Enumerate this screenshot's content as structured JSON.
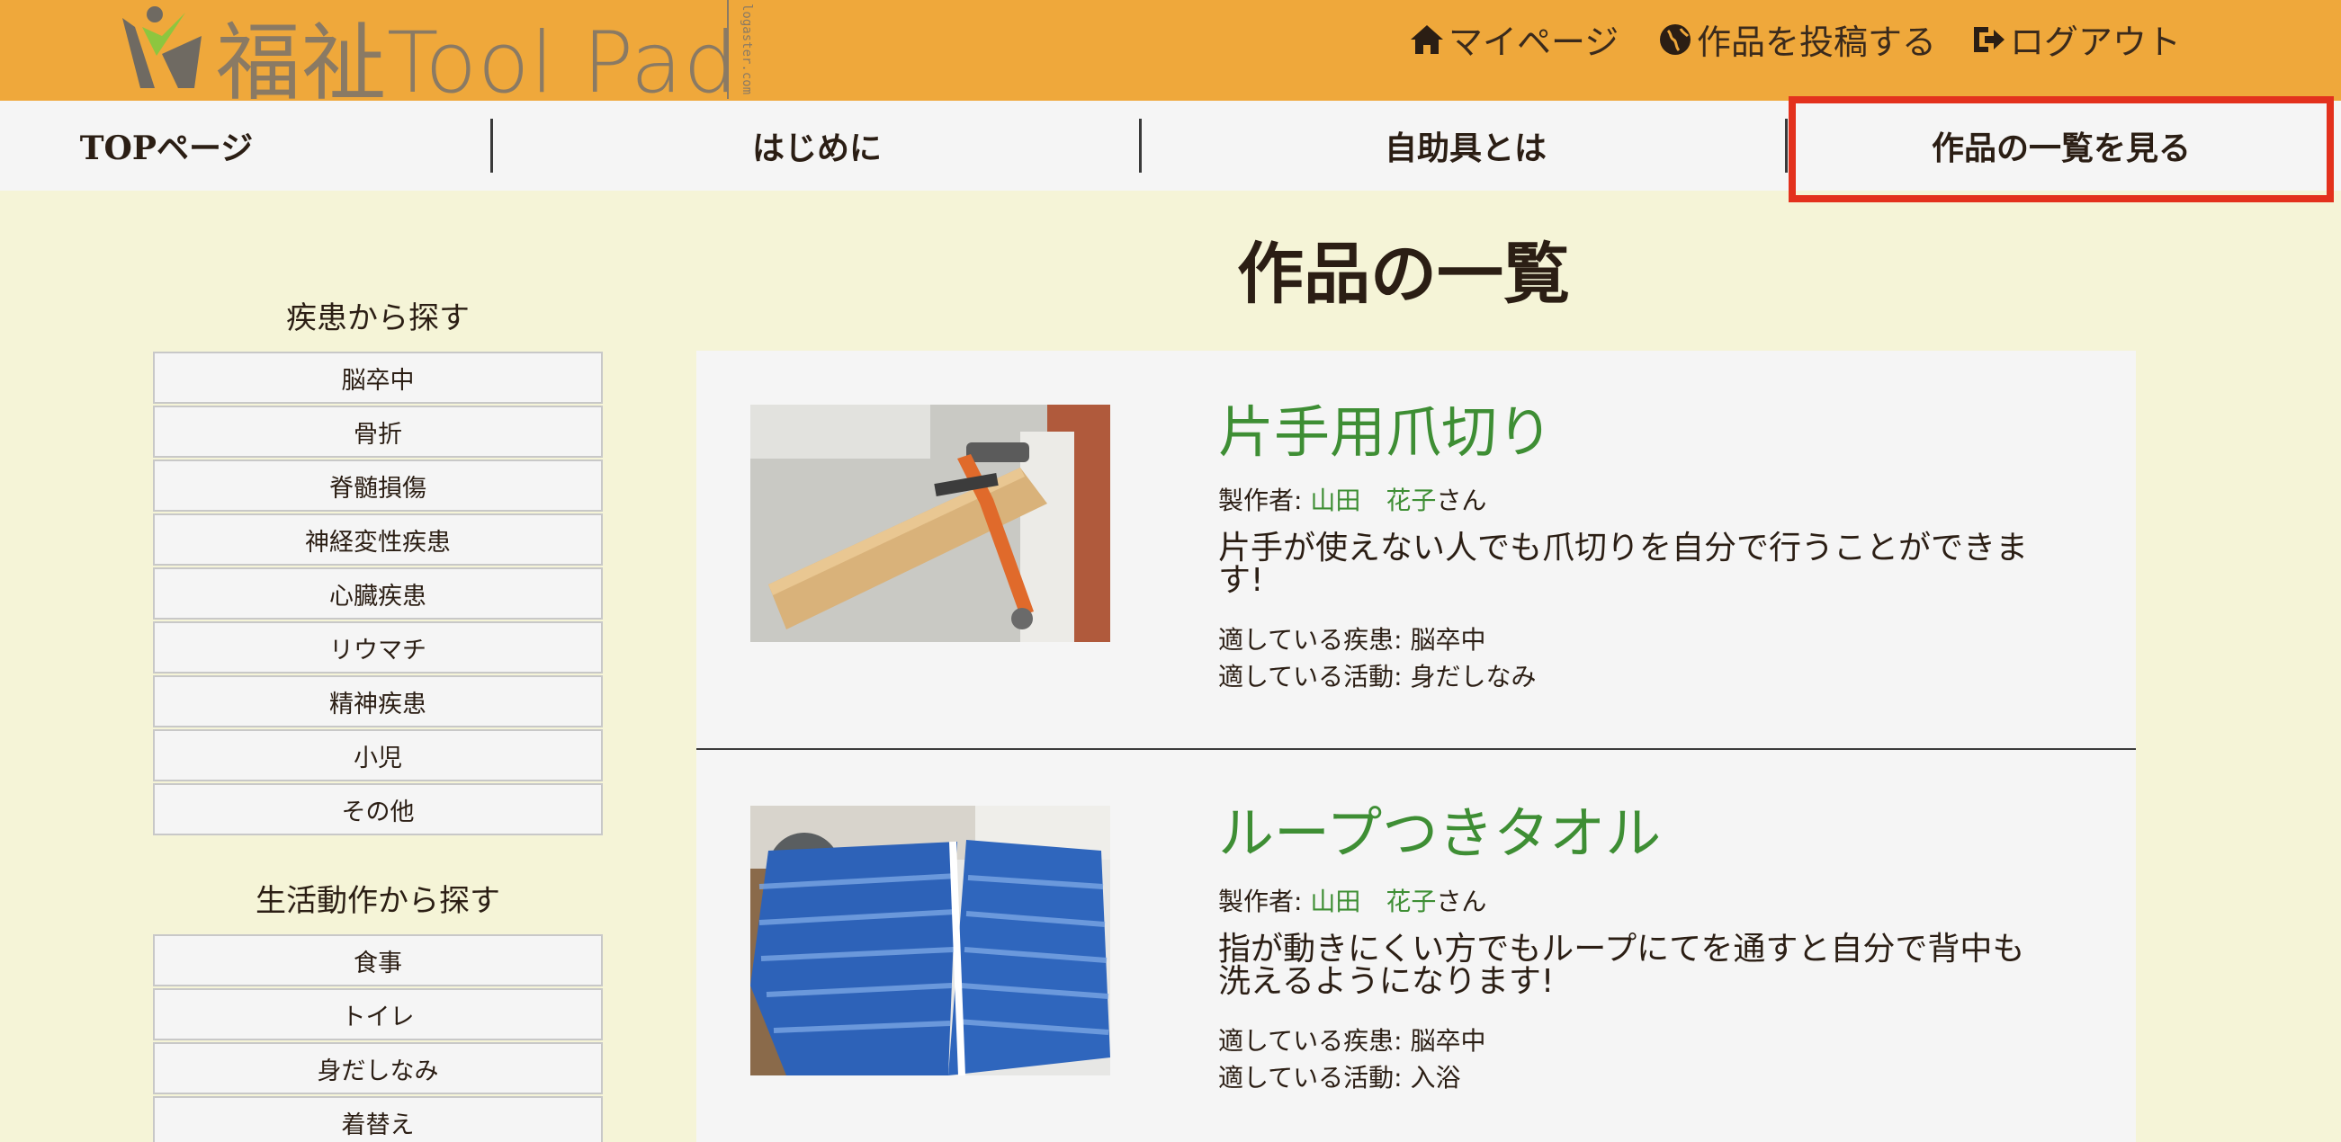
{
  "header": {
    "logo_text": "福祉Tool Pad",
    "logo_credit": "logaster.com",
    "links": [
      {
        "label": "マイページ",
        "icon": "home-icon"
      },
      {
        "label": "作品を投稿する",
        "icon": "globe-icon"
      },
      {
        "label": "ログアウト",
        "icon": "logout-icon"
      }
    ]
  },
  "mainnav": {
    "items": [
      {
        "label": "TOPページ"
      },
      {
        "label": "はじめに"
      },
      {
        "label": "自助具とは"
      },
      {
        "label": "作品の一覧を見る",
        "highlighted": true
      }
    ]
  },
  "page": {
    "title": "作品の一覧"
  },
  "sidebar": {
    "disease_heading": "疾患から探す",
    "diseases": [
      "脳卒中",
      "骨折",
      "脊髄損傷",
      "神経変性疾患",
      "心臓疾患",
      "リウマチ",
      "精神疾患",
      "小児",
      "その他"
    ],
    "activity_heading": "生活動作から探す",
    "activities": [
      "食事",
      "トイレ",
      "身だしなみ",
      "着替え"
    ]
  },
  "works": [
    {
      "title": "片手用爪切り",
      "creator_label": "製作者:",
      "creator_name": "山田　花子",
      "creator_suffix": "さん",
      "description": "片手が使えない人でも爪切りを自分で行うことができます!",
      "disease_label": "適している疾患:",
      "disease": "脳卒中",
      "activity_label": "適している活動:",
      "activity": "身だしなみ"
    },
    {
      "title": "ループつきタオル",
      "creator_label": "製作者:",
      "creator_name": "山田　花子",
      "creator_suffix": "さん",
      "description": "指が動きにくい方でもループにてを通すと自分で背中も洗えるようになります!",
      "disease_label": "適している疾患:",
      "disease": "脳卒中",
      "activity_label": "適している活動:",
      "activity": "入浴"
    }
  ],
  "colors": {
    "header_bg": "#efa83b",
    "page_bg": "#f5f4d7",
    "accent_green": "#3e8e34",
    "highlight_red": "#e3311d"
  }
}
